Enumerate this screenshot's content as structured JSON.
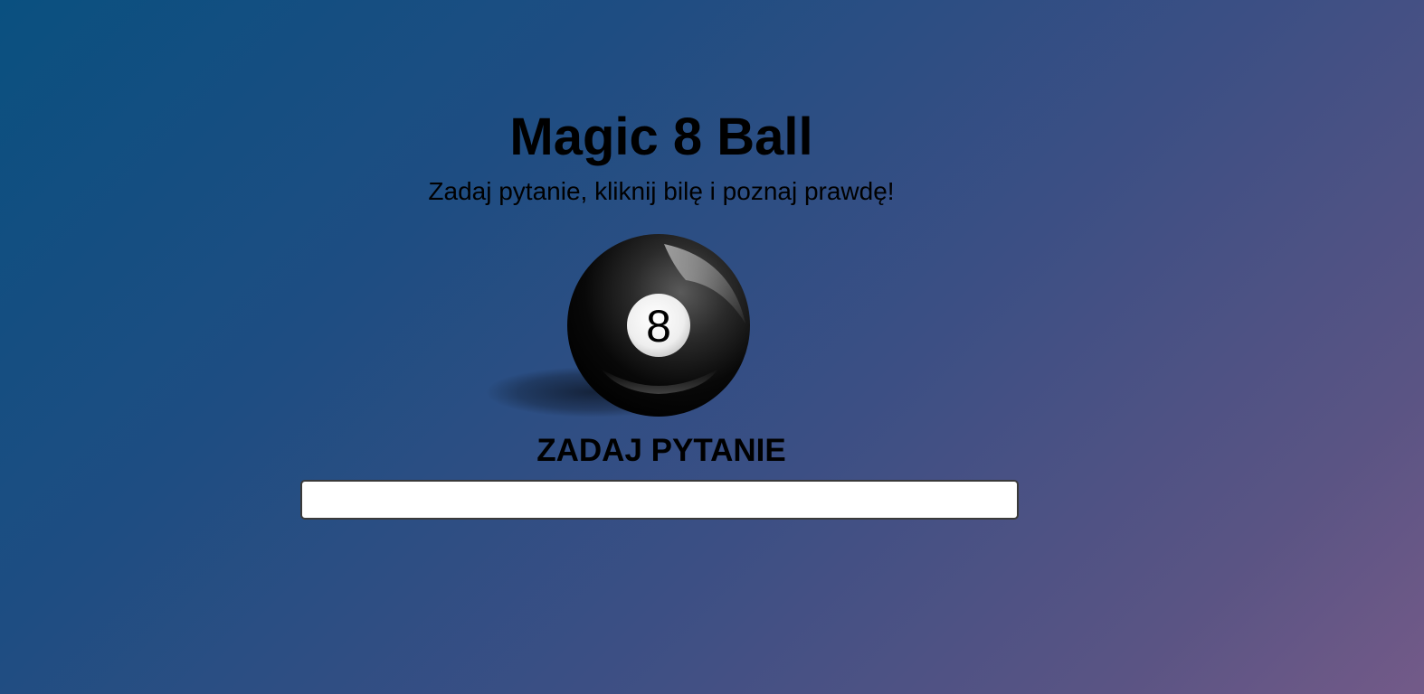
{
  "header": {
    "title": "Magic 8 Ball",
    "subtitle": "Zadaj pytanie, kliknij bilę i poznaj prawdę!"
  },
  "ball": {
    "number": "8",
    "icon": "magic-8-ball-icon"
  },
  "question": {
    "label": "ZADAJ PYTANIE",
    "value": "",
    "placeholder": ""
  },
  "colors": {
    "background_start": "#0a5080",
    "background_end": "#735a88",
    "ball": "#000000",
    "ball_window": "#ffffff"
  }
}
